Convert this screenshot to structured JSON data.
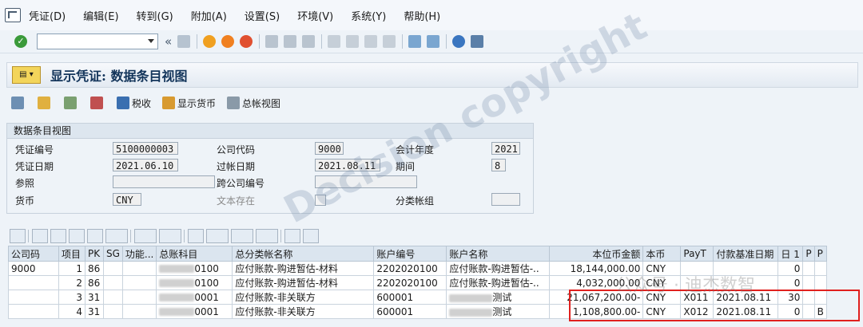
{
  "menu": {
    "items": [
      "凭证(D)",
      "编辑(E)",
      "转到(G)",
      "附加(A)",
      "设置(S)",
      "环境(V)",
      "系统(Y)",
      "帮助(H)"
    ]
  },
  "toolbar": {
    "back_label": "«",
    "ok_label": "✓",
    "command_value": ""
  },
  "title": "显示凭证: 数据条目视图",
  "app_toolbar": {
    "tax_label": "税收",
    "currency_label": "显示货币",
    "gl_view_label": "总帐视图"
  },
  "header": {
    "group_title": "数据条目视图",
    "doc_number_label": "凭证编号",
    "doc_number": "5100000003",
    "company_code_label": "公司代码",
    "company_code": "9000",
    "fiscal_year_label": "会计年度",
    "fiscal_year": "2021",
    "doc_date_label": "凭证日期",
    "doc_date": "2021.06.10",
    "posting_date_label": "过帐日期",
    "posting_date": "2021.08.11",
    "period_label": "期间",
    "period": "8",
    "reference_label": "参照",
    "cross_company_label": "跨公司编号",
    "currency_label": "货币",
    "currency": "CNY",
    "text_exists_label": "文本存在",
    "ledger_group_label": "分类帐组"
  },
  "grid": {
    "columns": [
      "公司码",
      "项目",
      "PK",
      "SG",
      "功能...",
      "总账科目",
      "总分类帐名称",
      "账户编号",
      "账户名称",
      "本位币金额",
      "本币",
      "PayT",
      "付款基准日期",
      "日 1",
      "P",
      "P"
    ],
    "rows": [
      {
        "company": "9000",
        "item": "1",
        "pk": "86",
        "sg": "",
        "func": "",
        "gl_suffix": "0100",
        "gl_name": "应付账款-购进暂估-材料",
        "account": "2202020100",
        "account_name": "应付账款-购进暂估-..",
        "amount": "18,144,000.00",
        "currency": "CNY",
        "payt": "",
        "base_date": "",
        "days": "0",
        "p1": "",
        "p2": ""
      },
      {
        "company": "",
        "item": "2",
        "pk": "86",
        "sg": "",
        "func": "",
        "gl_suffix": "0100",
        "gl_name": "应付账款-购进暂估-材料",
        "account": "2202020100",
        "account_name": "应付账款-购进暂估-..",
        "amount": "4,032,000.00",
        "currency": "CNY",
        "payt": "",
        "base_date": "",
        "days": "0",
        "p1": "",
        "p2": ""
      },
      {
        "company": "",
        "item": "3",
        "pk": "31",
        "sg": "",
        "func": "",
        "gl_suffix": "0001",
        "gl_name": "应付账款-非关联方",
        "account": "600001",
        "account_name": "测试",
        "amount": "21,067,200.00-",
        "currency": "CNY",
        "payt": "X011",
        "base_date": "2021.08.11",
        "days": "30",
        "p1": "",
        "p2": ""
      },
      {
        "company": "",
        "item": "4",
        "pk": "31",
        "sg": "",
        "func": "",
        "gl_suffix": "0001",
        "gl_name": "应付账款-非关联方",
        "account": "600001",
        "account_name": "测试",
        "amount": "1,108,800.00-",
        "currency": "CNY",
        "payt": "X012",
        "base_date": "2021.08.11",
        "days": "0",
        "p1": "",
        "p2": "B"
      }
    ]
  },
  "watermark": "Decision copyright",
  "watermark2": "公众号 · 迪杰数智",
  "colors": {
    "highlight_box": "#e0201e",
    "title_text": "#12345a"
  }
}
